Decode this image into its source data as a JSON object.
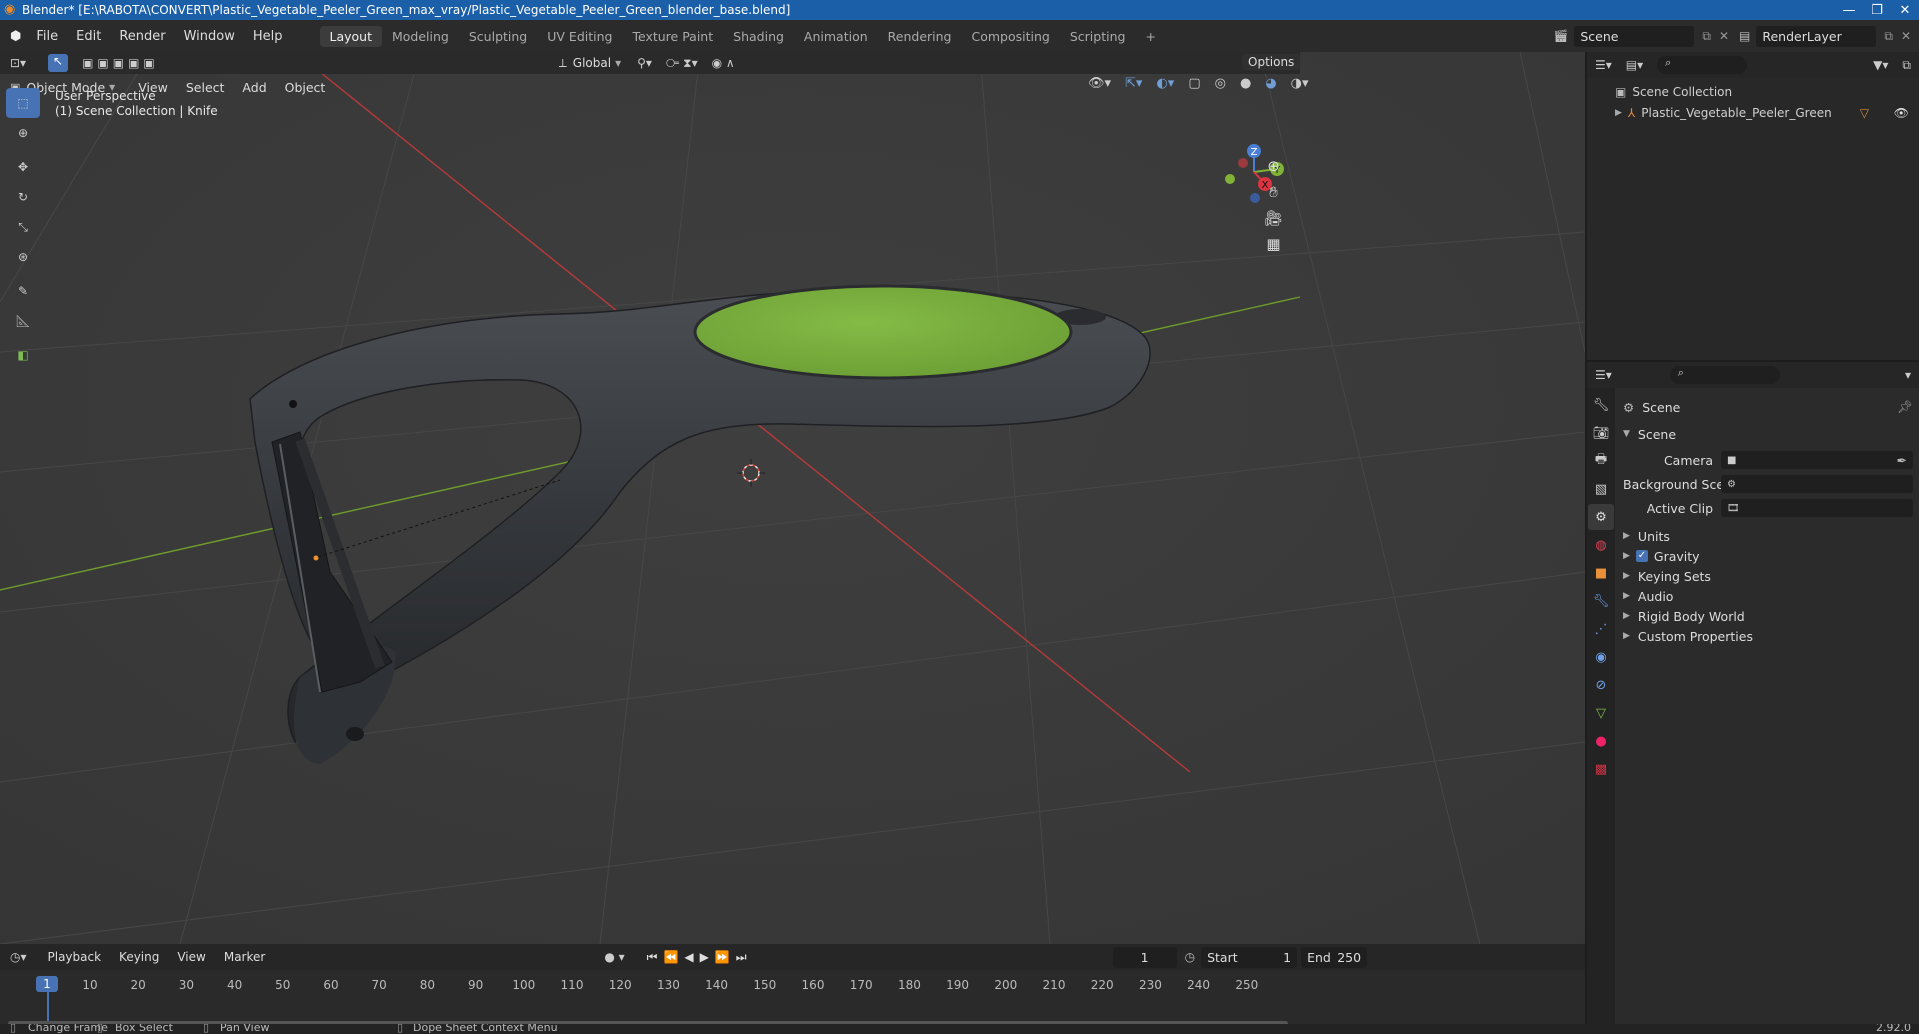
{
  "window": {
    "title": "Blender* [E:\\RABOTA\\CONVERT\\Plastic_Vegetable_Peeler_Green_max_vray/Plastic_Vegetable_Peeler_Green_blender_base.blend]",
    "controls": [
      "—",
      "❐",
      "✕"
    ]
  },
  "menu": {
    "items": [
      "File",
      "Edit",
      "Render",
      "Window",
      "Help"
    ],
    "workspaces": [
      "Layout",
      "Modeling",
      "Sculpting",
      "UV Editing",
      "Texture Paint",
      "Shading",
      "Animation",
      "Rendering",
      "Compositing",
      "Scripting"
    ],
    "active_workspace": "Layout",
    "add_workspace": "+",
    "scene": "Scene",
    "view_layer": "RenderLayer"
  },
  "viewport": {
    "mode": "Object Mode",
    "menus": [
      "View",
      "Select",
      "Add",
      "Object"
    ],
    "orientation": "Global",
    "options": "Options",
    "overlay_line1": "User Perspective",
    "overlay_line2": "(1) Scene Collection | Knife",
    "gizmo": {
      "z": "Z",
      "y": "Y",
      "x": "X"
    },
    "colors": {
      "background": "#3a3a3a",
      "grid": "#454545",
      "x_axis": "#b8393a",
      "y_axis": "#6f9c2c",
      "body": "#3a3d41",
      "green_cap": "#7bb33f"
    }
  },
  "toolbar": {
    "tools": [
      "select-box-icon",
      "cursor-icon",
      "move-icon",
      "rotate-icon",
      "scale-icon",
      "transform-icon",
      "annotate-icon",
      "measure-icon",
      "add-cube-icon"
    ]
  },
  "outliner": {
    "root": "Scene Collection",
    "items": [
      "Plastic_Vegetable_Peeler_Green"
    ]
  },
  "properties": {
    "context": "Scene",
    "panel": "Scene",
    "fields": [
      {
        "label": "Camera",
        "value": ""
      },
      {
        "label": "Background Scene",
        "value": ""
      },
      {
        "label": "Active Clip",
        "value": ""
      }
    ],
    "sections": [
      "Units",
      "Gravity",
      "Keying Sets",
      "Audio",
      "Rigid Body World",
      "Custom Properties"
    ],
    "gravity_checked": true
  },
  "timeline": {
    "menus": [
      "Playback",
      "Keying",
      "View",
      "Marker"
    ],
    "current_frame": "1",
    "start_label": "Start",
    "start": "1",
    "end_label": "End",
    "end": "250",
    "ticks": [
      "1",
      "10",
      "20",
      "30",
      "40",
      "50",
      "60",
      "70",
      "80",
      "90",
      "100",
      "110",
      "120",
      "130",
      "140",
      "150",
      "160",
      "170",
      "180",
      "190",
      "200",
      "210",
      "220",
      "230",
      "240",
      "250"
    ]
  },
  "status": {
    "items": [
      "Change Frame",
      "Box Select",
      "Pan View",
      "Dope Sheet Context Menu"
    ],
    "version": "2.92.0"
  }
}
